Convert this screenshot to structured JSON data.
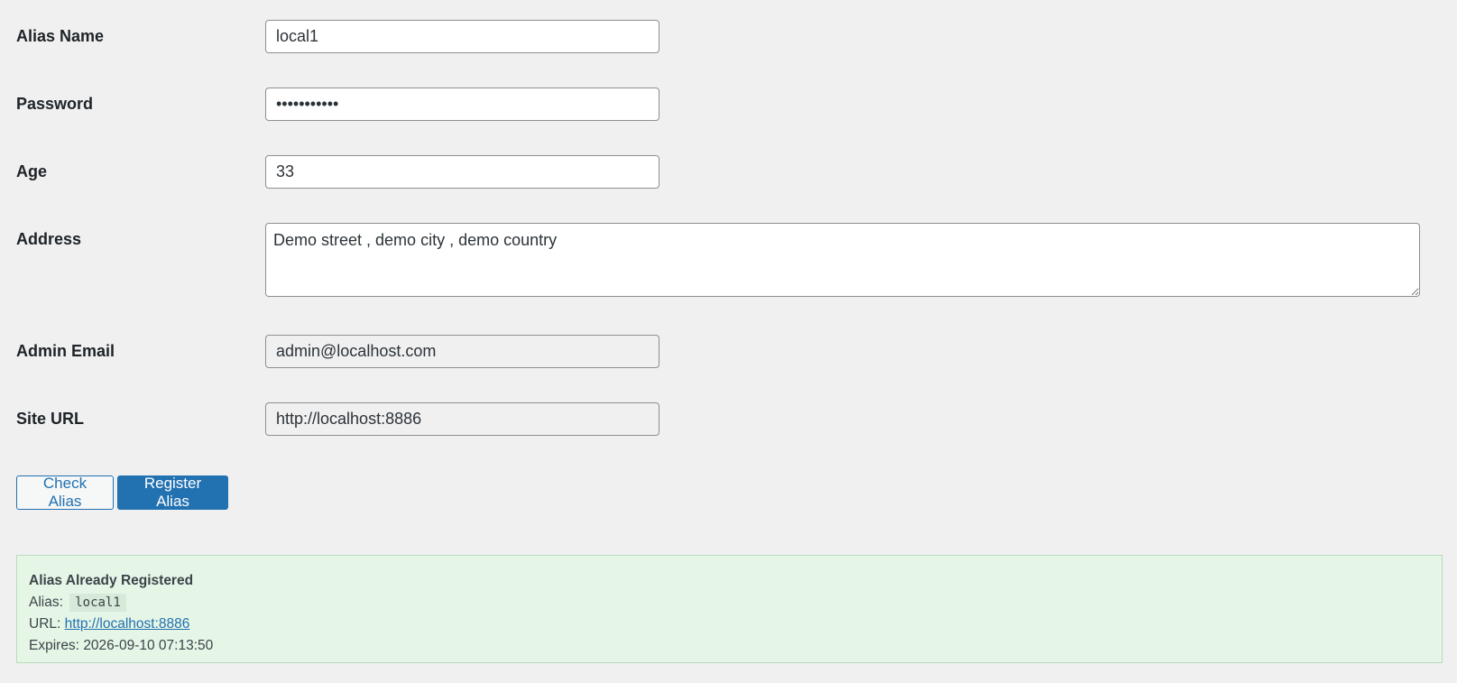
{
  "form": {
    "alias_name": {
      "label": "Alias Name",
      "value": "local1"
    },
    "password": {
      "label": "Password",
      "value": "password123"
    },
    "age": {
      "label": "Age",
      "value": "33"
    },
    "address": {
      "label": "Address",
      "value": "Demo street , demo city , demo country"
    },
    "admin_email": {
      "label": "Admin Email",
      "value": "admin@localhost.com"
    },
    "site_url": {
      "label": "Site URL",
      "value": "http://localhost:8886"
    }
  },
  "buttons": {
    "check_alias": "Check Alias",
    "register_alias": "Register Alias"
  },
  "notice": {
    "title": "Alias Already Registered",
    "alias_label": "Alias:",
    "alias_value": "local1",
    "url_label": "URL:",
    "url_value": "http://localhost:8886",
    "expires_label": "Expires:",
    "expires_value": "2026-09-10 07:13:50"
  },
  "colors": {
    "background": "#f0f0f1",
    "primary": "#2271b1",
    "success_bg": "#e5f5e6"
  }
}
